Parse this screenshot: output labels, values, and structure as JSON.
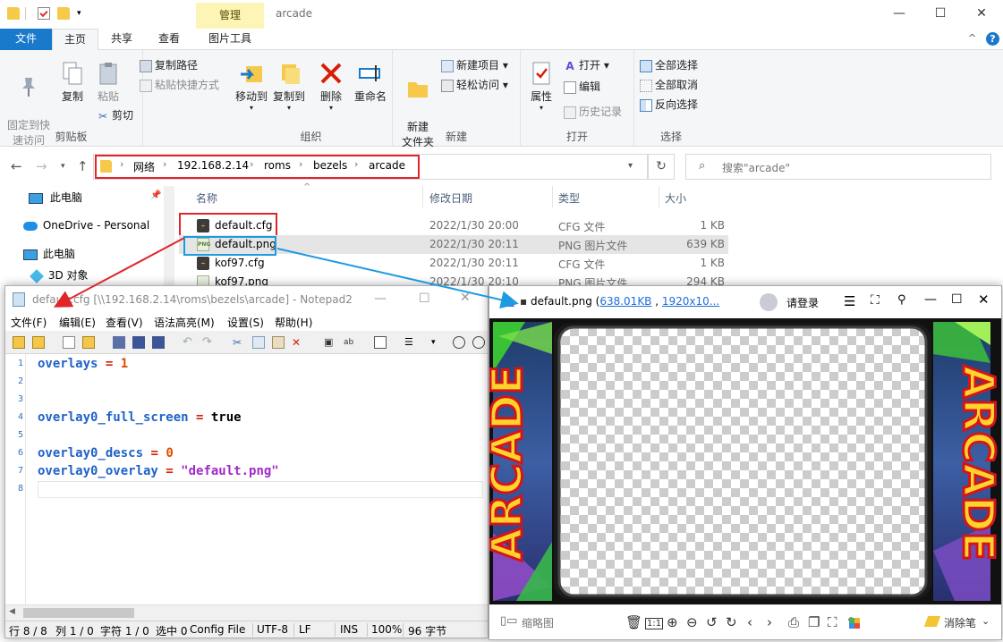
{
  "explorer": {
    "window_title": "arcade",
    "context_tab": "管理",
    "tabs": [
      "文件",
      "主页",
      "共享",
      "查看",
      "图片工具"
    ],
    "ribbon": {
      "clipboard": {
        "pin": "固定到快\n速访问",
        "copy": "复制",
        "paste": "粘贴",
        "copy_path": "复制路径",
        "paste_shortcut": "粘贴快捷方式",
        "cut": "剪切",
        "group": "剪贴板"
      },
      "organize": {
        "move_to": "移动到",
        "copy_to": "复制到",
        "delete": "删除",
        "rename": "重命名",
        "group": "组织"
      },
      "new": {
        "new_folder": "新建\n文件夹",
        "new_item": "新建项目",
        "easy_access": "轻松访问",
        "group": "新建"
      },
      "open": {
        "properties": "属性",
        "open": "打开",
        "edit": "编辑",
        "history": "历史记录",
        "group": "打开"
      },
      "select": {
        "select_all": "全部选择",
        "select_none": "全部取消",
        "invert": "反向选择",
        "group": "选择"
      }
    },
    "breadcrumb": [
      "网络",
      "192.168.2.14",
      "roms",
      "bezels",
      "arcade"
    ],
    "search_placeholder": "搜索\"arcade\"",
    "nav_pane": [
      "此电脑",
      "OneDrive - Personal",
      "此电脑",
      "3D 对象"
    ],
    "columns": [
      "名称",
      "修改日期",
      "类型",
      "大小"
    ],
    "files": [
      {
        "name": "default.cfg",
        "date": "2022/1/30 20:00",
        "type": "CFG 文件",
        "size": "1 KB"
      },
      {
        "name": "default.png",
        "date": "2022/1/30 20:11",
        "type": "PNG 图片文件",
        "size": "639 KB"
      },
      {
        "name": "kof97.cfg",
        "date": "2022/1/30 20:11",
        "type": "CFG 文件",
        "size": "1 KB"
      },
      {
        "name": "kof97.png",
        "date": "2022/1/30 20:10",
        "type": "PNG 图片文件",
        "size": "294 KB"
      }
    ]
  },
  "notepad": {
    "title_file": "default.cfg",
    "title_path": "[\\\\192.168.2.14\\roms\\bezels\\arcade] - Notepad2",
    "menu": [
      "文件(F)",
      "编辑(E)",
      "查看(V)",
      "语法高亮(M)",
      "设置(S)",
      "帮助(H)"
    ],
    "line_numbers": [
      "1",
      "2",
      "3",
      "4",
      "5",
      "6",
      "7",
      "8"
    ],
    "code": {
      "l1_key": "overlays",
      "l1_op": " = ",
      "l1_val": "1",
      "l4_key": "overlay0_full_screen",
      "l4_op": " = ",
      "l4_val": "true",
      "l6_key": "overlay0_descs",
      "l6_op": " = ",
      "l6_val": "0",
      "l7_key": "overlay0_overlay",
      "l7_op": " = ",
      "l7_val": "\"default.png\""
    },
    "status": [
      "行 8 / 8",
      "列 1 / 0",
      "字符 1 / 0",
      "选中 0",
      "Config File",
      "UTF-8",
      "LF",
      "INS",
      "100%",
      "96 字节"
    ]
  },
  "viewer": {
    "title_file": "default.png (",
    "title_size": "638.01KB",
    "title_sep": " , ",
    "title_res": "1920x10...",
    "login": "请登录",
    "bezel_text": "ARCADE",
    "thumbnail_label": "缩略图",
    "one_to_one": "1:1",
    "eraser_label": "消除笔"
  },
  "colors": {
    "highlight_red": "#e0262b",
    "highlight_blue": "#1e9be0",
    "accent": "#1979ca"
  }
}
